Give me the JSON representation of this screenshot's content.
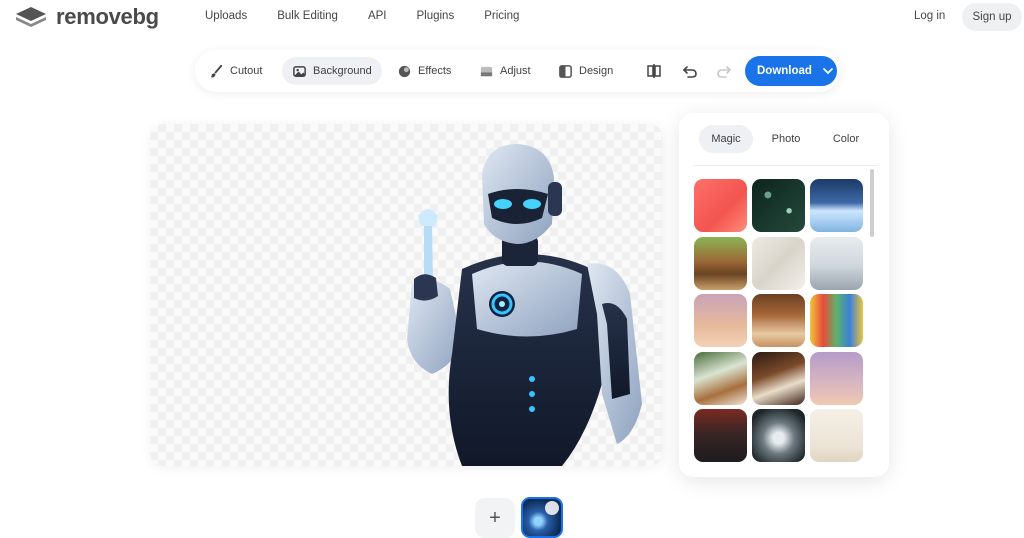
{
  "brand": {
    "name_part1": "remove",
    "name_part2": "bg"
  },
  "nav": {
    "links": [
      "Uploads",
      "Bulk Editing",
      "API",
      "Plugins",
      "Pricing"
    ],
    "login": "Log in",
    "signup": "Sign up"
  },
  "toolbar": {
    "tools": [
      {
        "label": "Cutout",
        "icon": "brush-icon"
      },
      {
        "label": "Background",
        "icon": "image-icon",
        "active": true
      },
      {
        "label": "Effects",
        "icon": "effects-icon"
      },
      {
        "label": "Adjust",
        "icon": "adjust-icon"
      },
      {
        "label": "Design",
        "icon": "design-icon"
      }
    ],
    "download_label": "Download"
  },
  "panel": {
    "tabs": [
      "Magic",
      "Photo",
      "Color"
    ],
    "active_tab": "Magic"
  },
  "colors": {
    "accent": "#1a73e8",
    "active_bg": "#eef0f3"
  }
}
